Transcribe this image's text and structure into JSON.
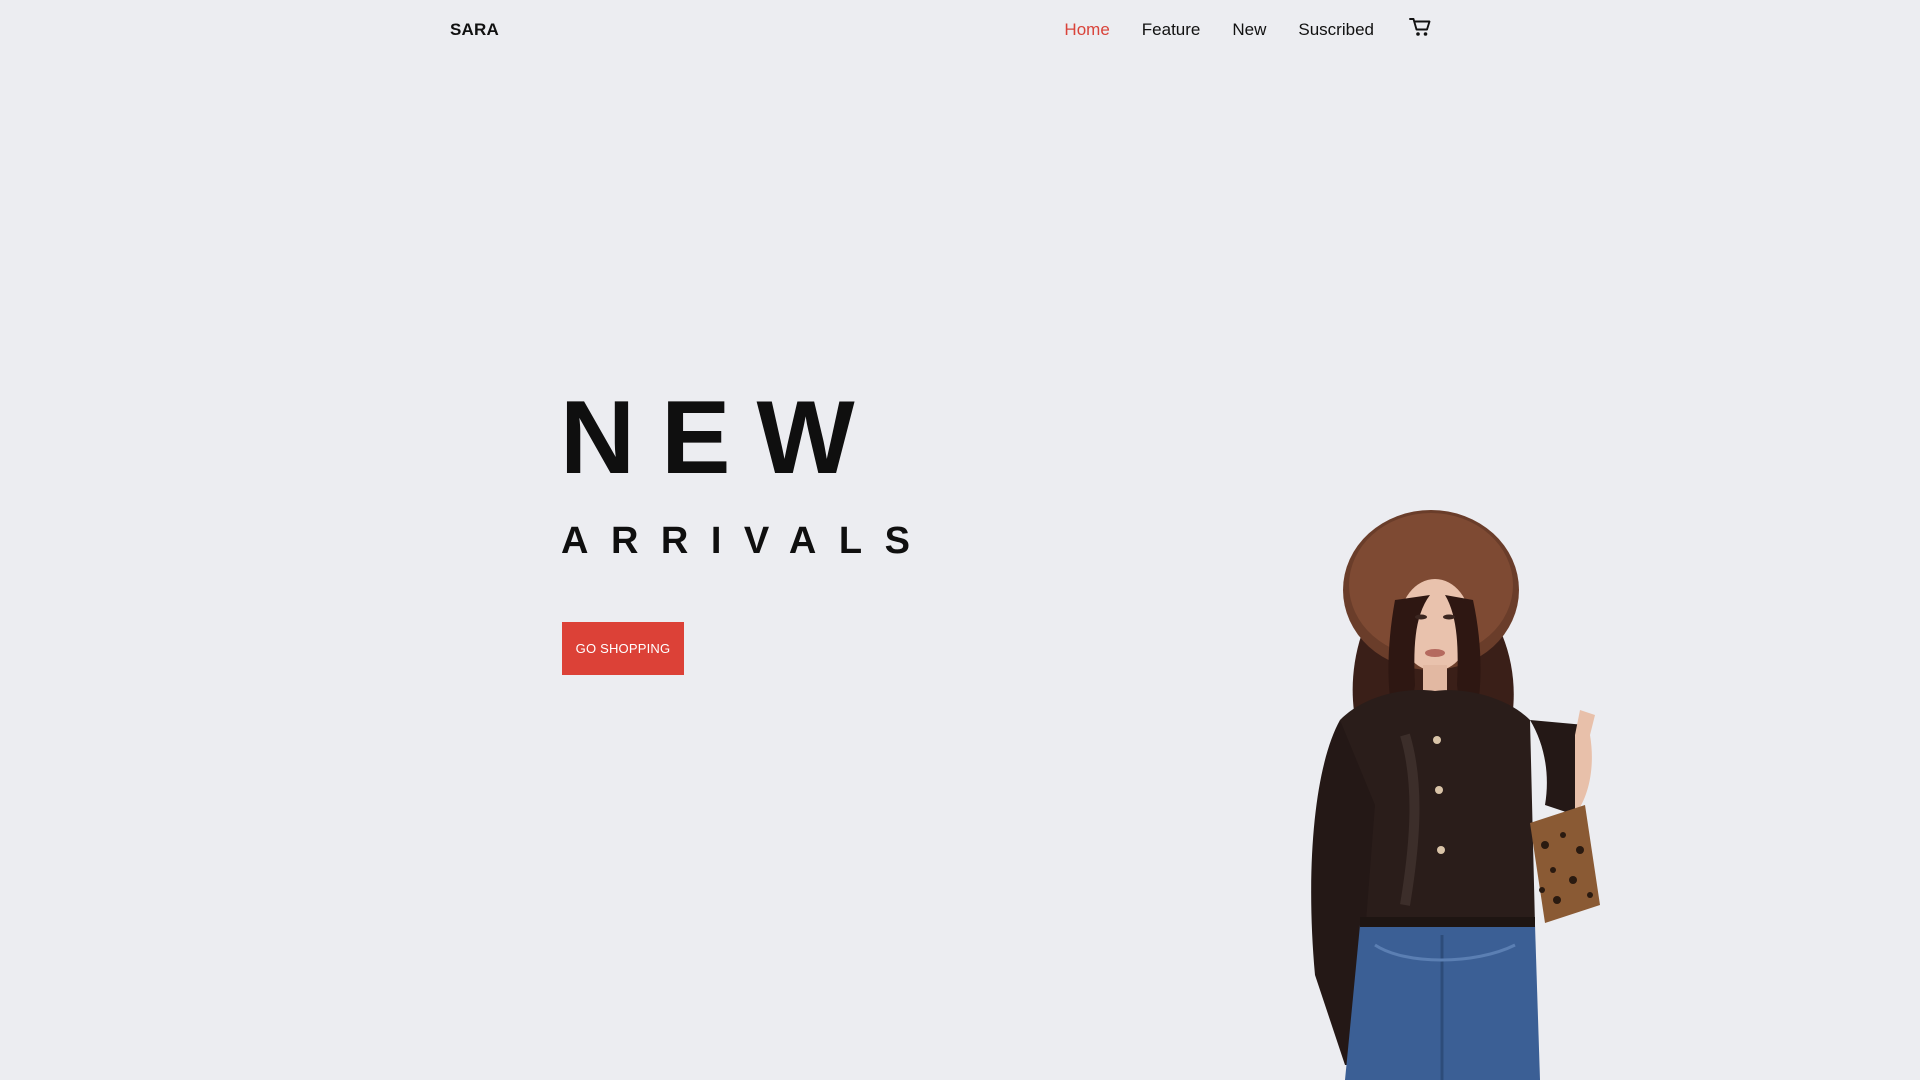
{
  "header": {
    "logo": "SARA",
    "nav": [
      {
        "label": "Home",
        "active": true
      },
      {
        "label": "Feature",
        "active": false
      },
      {
        "label": "New",
        "active": false
      },
      {
        "label": "Suscribed",
        "active": false
      }
    ],
    "cart_icon": "cart-icon"
  },
  "hero": {
    "title": "NEW",
    "subtitle": "ARRIVALS",
    "cta_label": "GO SHOPPING",
    "image_subject": "model-photo"
  },
  "colors": {
    "background": "#ecedf1",
    "accent": "#dc4137",
    "text": "#111111"
  }
}
